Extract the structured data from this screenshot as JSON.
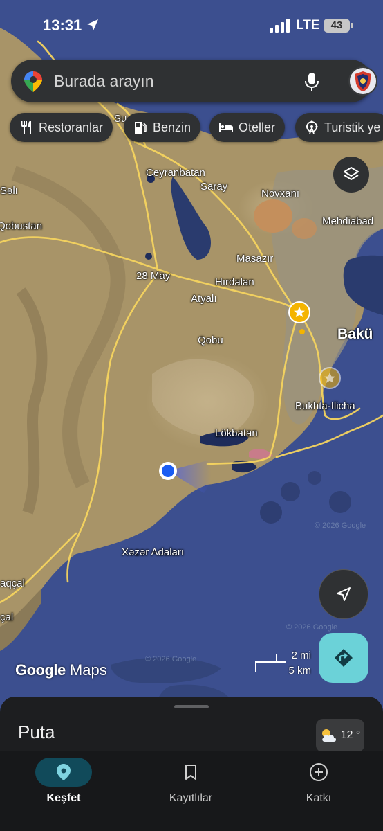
{
  "status_bar": {
    "time": "13:31",
    "carrier": "LTE",
    "battery": "43"
  },
  "search": {
    "placeholder": "Burada arayın"
  },
  "chips": [
    {
      "label": "Restoranlar",
      "icon": "fork-knife-icon"
    },
    {
      "label": "Benzin",
      "icon": "gas-station-icon"
    },
    {
      "label": "Oteller",
      "icon": "bed-icon"
    },
    {
      "label": "Turistik ye",
      "icon": "ferris-wheel-icon"
    }
  ],
  "map_labels": {
    "ceyranbatan": "Ceyranbatan",
    "saray": "Saray",
    "novxani": "Novxanı",
    "mehdiabad": "Mehdiabad",
    "qobustan": "Qobustan",
    "masazir": "Masazır",
    "may28": "28 May",
    "hirdalan": "Hırdalan",
    "atyali": "Atyalı",
    "baku": "Bakü",
    "qobu": "Qobu",
    "bukhta": "Bukhta-Ilicha",
    "lokbatan": "Lökbatan",
    "xezer": "Xəzər Adaları",
    "faint_copy": "© 2026 Google",
    "left_edge1": "aqçal",
    "left_edge2": "çal",
    "left_edge3": "Səlı",
    "left_edge4": "Su"
  },
  "scale": {
    "miles": "2 mi",
    "km": "5 km"
  },
  "logo": {
    "google": "Google",
    "maps": "Maps"
  },
  "sheet": {
    "place": "Puta",
    "weather": "12 °"
  },
  "nav": [
    {
      "label": "Keşfet",
      "icon": "location-pin-icon",
      "active": true
    },
    {
      "label": "Kayıtlılar",
      "icon": "bookmark-icon",
      "active": false
    },
    {
      "label": "Katkı",
      "icon": "plus-circle-icon",
      "active": false
    }
  ],
  "colors": {
    "sea": "#3c4f8f",
    "land": "#a89468",
    "accent": "#6bd2d8",
    "active_nav": "#114a5a"
  }
}
